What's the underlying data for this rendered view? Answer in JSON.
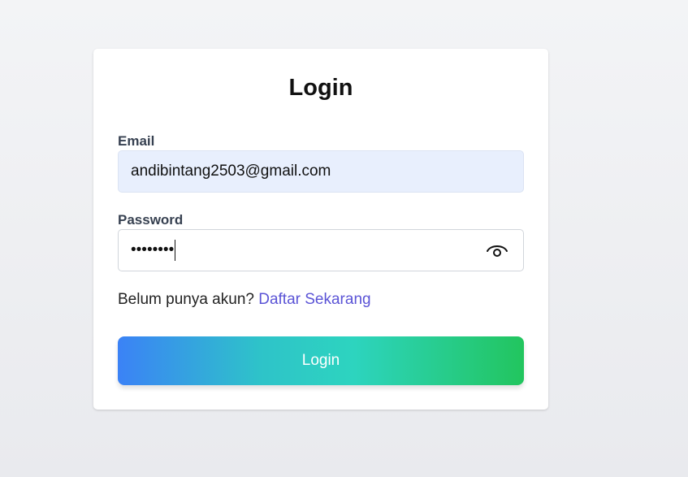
{
  "form": {
    "title": "Login",
    "email": {
      "label": "Email",
      "value": "andibintang2503@gmail.com"
    },
    "password": {
      "label": "Password",
      "masked_value": "••••••••",
      "toggle_icon": "eye-icon"
    },
    "register": {
      "prompt": "Belum punya akun?",
      "link_text": "Daftar Sekarang"
    },
    "submit_label": "Login"
  },
  "colors": {
    "link": "#5b54d6",
    "button_gradient_start": "#3b82f6",
    "button_gradient_mid": "#2dd4bf",
    "button_gradient_end": "#22c55e",
    "email_autofill_bg": "#e8effd"
  }
}
